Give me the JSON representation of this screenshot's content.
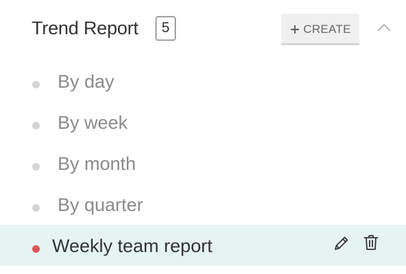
{
  "header": {
    "title": "Trend Report",
    "count": "5",
    "create_button": {
      "label": "CREATE",
      "icon": "plus-icon"
    },
    "collapse_icon": "chevron-up-icon"
  },
  "reports": [
    {
      "label": "By day",
      "active": false
    },
    {
      "label": "By week",
      "active": false
    },
    {
      "label": "By month",
      "active": false
    },
    {
      "label": "By quarter",
      "active": false
    },
    {
      "label": "Weekly team report",
      "active": true,
      "actions": [
        "pencil-icon",
        "trash-icon"
      ]
    }
  ],
  "colors": {
    "active_row_background": "#e6f3f3",
    "active_bullet": "#d9575a",
    "inactive_bullet": "#d4d4d4",
    "inactive_text": "#8a8a8a",
    "active_text": "#333333"
  }
}
